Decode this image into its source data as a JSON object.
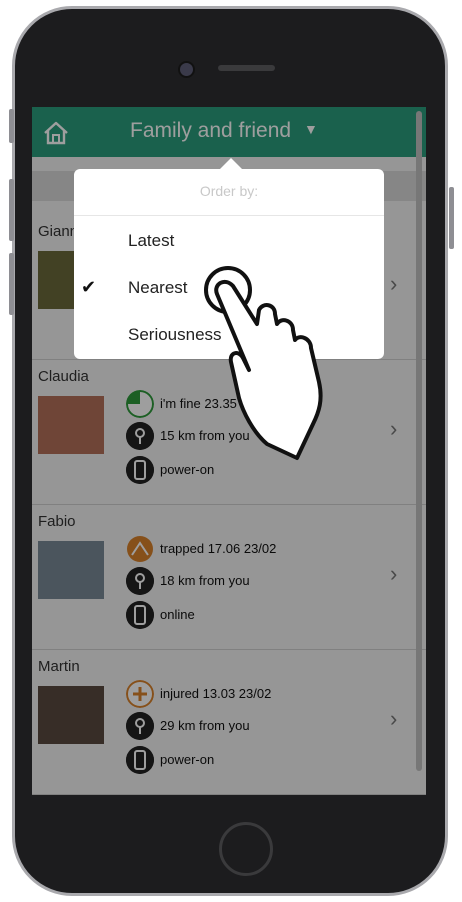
{
  "header": {
    "title": "Family and friend",
    "caret": "▼"
  },
  "order_menu": {
    "title": "Order by:",
    "options": [
      "Latest",
      "Nearest",
      "Seriousness"
    ],
    "selected_index": 1,
    "check": "✔"
  },
  "contacts": [
    {
      "name": "Giann"
    },
    {
      "name": "Claudia",
      "status_text": "i'm fine 23.35 23/02",
      "distance": "15 km from you",
      "device": "power-on",
      "status_icon": "fine-status-icon"
    },
    {
      "name": "Fabio",
      "status_text": "trapped 17.06 23/02",
      "distance": "18 km from you",
      "device": "online",
      "status_icon": "trapped-status-icon"
    },
    {
      "name": "Martin",
      "status_text": "injured 13.03 23/02",
      "distance": "29 km from you",
      "device": "power-on",
      "status_icon": "injured-status-icon"
    }
  ],
  "chevron": "›",
  "colors": {
    "accent": "#2a9d7c",
    "status_orange": "#d9822b",
    "status_green": "#2e9a3a"
  }
}
